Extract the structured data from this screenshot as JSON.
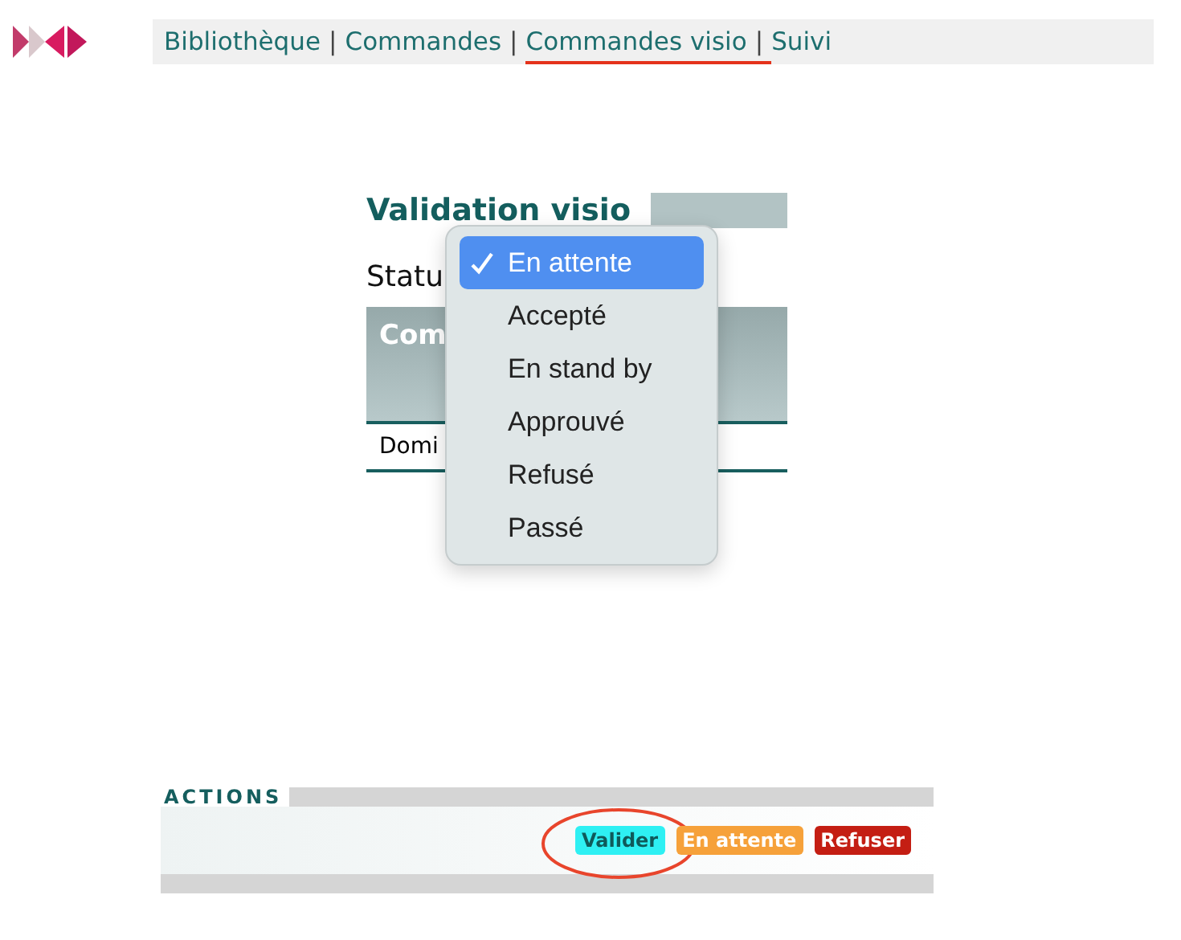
{
  "nav": {
    "items": [
      {
        "label": "Bibliothèque",
        "separator_after": "|",
        "selected": false
      },
      {
        "label": "Commandes",
        "separator_after": "|",
        "selected": false
      },
      {
        "label": "Commandes visio",
        "separator_after": "|",
        "selected": true
      },
      {
        "label": "Suivi",
        "selected": false
      }
    ]
  },
  "title": "Validation visio",
  "status_label": "Statu",
  "table": {
    "header": "Com",
    "row": "Domi"
  },
  "dropdown": {
    "options": [
      {
        "label": "En attente",
        "selected": true
      },
      {
        "label": "Accepté",
        "selected": false
      },
      {
        "label": "En stand by",
        "selected": false
      },
      {
        "label": "Approuvé",
        "selected": false
      },
      {
        "label": "Refusé",
        "selected": false
      },
      {
        "label": "Passé",
        "selected": false
      }
    ]
  },
  "actions": {
    "title": "ACTIONS",
    "buttons": [
      {
        "label": "Valider",
        "kind": "validate",
        "highlighted": true
      },
      {
        "label": "En attente",
        "kind": "wait",
        "highlighted": false
      },
      {
        "label": "Refuser",
        "kind": "refuse",
        "highlighted": false
      }
    ]
  }
}
